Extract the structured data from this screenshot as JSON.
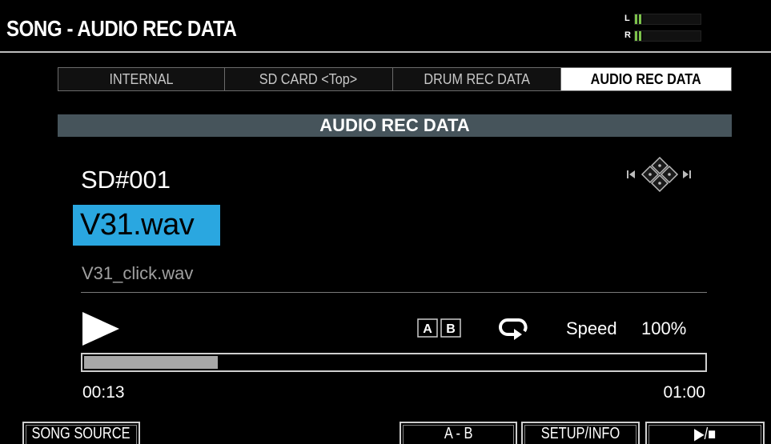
{
  "header": {
    "title": "SONG - AUDIO REC DATA",
    "meter": {
      "left_label": "L",
      "right_label": "R",
      "left_level": 0.12,
      "right_level": 0.12
    }
  },
  "tabs": [
    {
      "label": "INTERNAL",
      "active": false
    },
    {
      "label": "SD CARD <Top>",
      "active": false
    },
    {
      "label": "DRUM REC DATA",
      "active": false
    },
    {
      "label": "AUDIO REC DATA",
      "active": true
    }
  ],
  "section": {
    "title": "AUDIO REC DATA"
  },
  "file": {
    "slot": "SD#001",
    "name": "V31.wav",
    "sub_name": "V31_click.wav"
  },
  "transport": {
    "play_icon": "play-icon",
    "ab_icon": "ab-repeat-icon",
    "ab_labels": [
      "A",
      "B"
    ],
    "loop_icon": "loop-icon",
    "speed_label": "Speed",
    "speed_value": "100%",
    "progress": 0.216,
    "time_current": "00:13",
    "time_total": "01:00"
  },
  "function_keys": [
    {
      "label": "SONG SOURCE"
    },
    {
      "label": "A - B"
    },
    {
      "label": "SETUP/INFO"
    },
    {
      "label": "▶/■"
    }
  ],
  "colors": {
    "highlight": "#2aa7e0",
    "section_bar": "#46545b",
    "meter_green": "#7cc24b"
  }
}
